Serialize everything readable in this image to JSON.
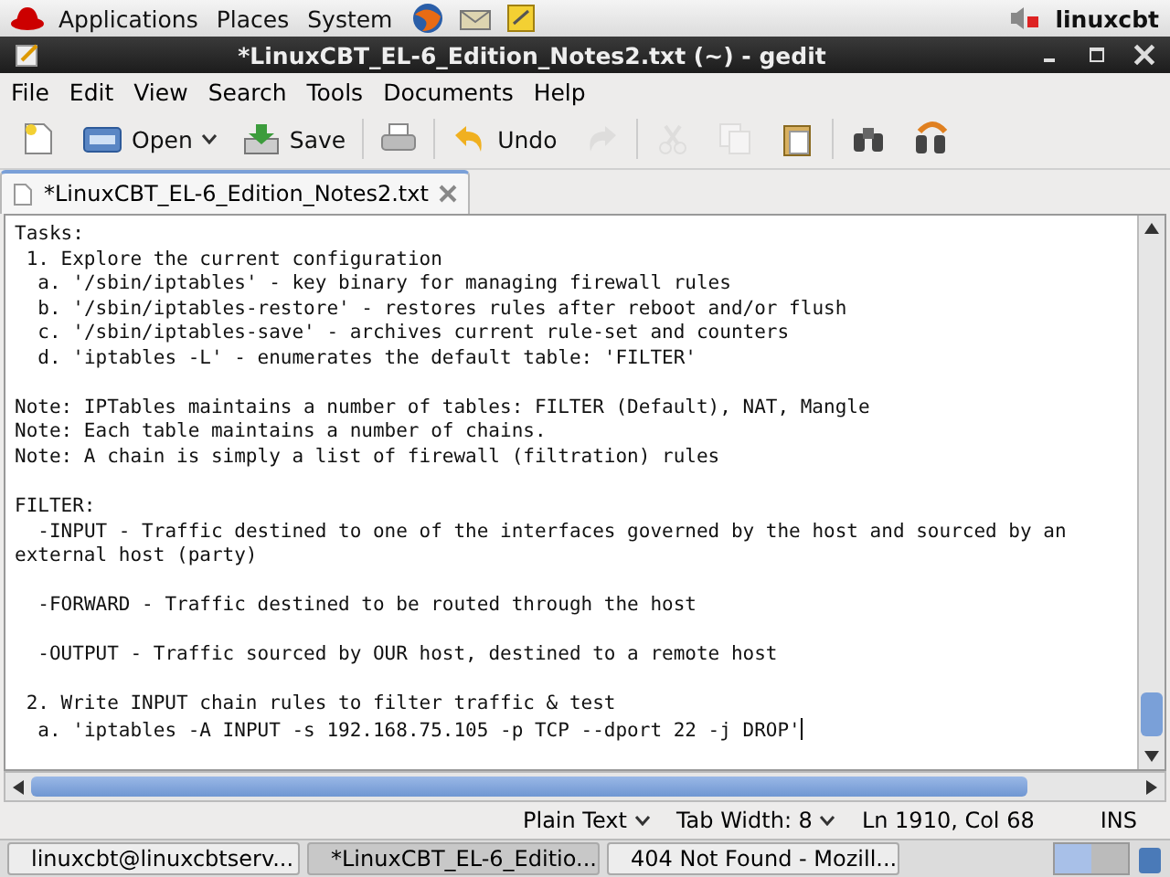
{
  "top_panel": {
    "menus": [
      "Applications",
      "Places",
      "System"
    ],
    "user": "linuxcbt"
  },
  "window": {
    "title": "*LinuxCBT_EL-6_Edition_Notes2.txt (~) - gedit"
  },
  "menu": [
    "File",
    "Edit",
    "View",
    "Search",
    "Tools",
    "Documents",
    "Help"
  ],
  "toolbar": [
    {
      "disabled": false
    },
    {
      "label": "Open",
      "disabled": false
    },
    {
      "label": "Save",
      "disabled": false
    },
    {
      "disabled": false
    },
    {
      "label": "Undo",
      "disabled": false
    },
    {
      "disabled": true
    },
    {
      "disabled": true
    },
    {
      "disabled": true
    },
    {
      "disabled": false
    },
    {
      "disabled": false
    },
    {
      "disabled": false
    }
  ],
  "tabs": [
    {
      "label": "*LinuxCBT_EL-6_Edition_Notes2.txt",
      "selected": true
    }
  ],
  "editor": {
    "blocks": [
      [
        "Tasks:",
        " 1. Explore the current configuration",
        "  a. '/sbin/iptables' - key binary for managing firewall rules",
        "  b. '/sbin/iptables-restore' - restores rules after reboot and/or flush",
        "  c. '/sbin/iptables-save' - archives current rule-set and counters",
        "  d. 'iptables -L' - enumerates the default table: 'FILTER'"
      ],
      [
        "Note: IPTables maintains a number of tables: FILTER (Default), NAT, Mangle",
        "Note: Each table maintains a number of chains.",
        "Note: A chain is simply a list of firewall (filtration) rules"
      ],
      [
        "FILTER:",
        "  -INPUT - Traffic destined to one of the interfaces governed by the host and sourced by an external host (party)"
      ],
      [
        "  -FORWARD - Traffic destined to be routed through the host"
      ],
      [
        "  -OUTPUT - Traffic sourced by OUR host, destined to a remote host"
      ],
      [
        " 2. Write INPUT chain rules to filter traffic & test",
        "  a. 'iptables -A INPUT -s 192.168.75.105 -p TCP --dport 22 -j DROP'"
      ]
    ]
  },
  "status_bar": [
    {
      "text": "Plain Text",
      "dropdown": true
    },
    {
      "text": "Tab Width: 8",
      "dropdown": true
    },
    {
      "text": "Ln 1910, Col 68",
      "dropdown": false
    },
    {
      "text": "INS",
      "dropdown": false
    }
  ],
  "taskbar": [
    {
      "label": "linuxcbt@linuxcbtserv...",
      "selected": false
    },
    {
      "label": "*LinuxCBT_EL-6_Editio...",
      "selected": true
    },
    {
      "label": "404 Not Found - Mozill...",
      "selected": false
    }
  ]
}
